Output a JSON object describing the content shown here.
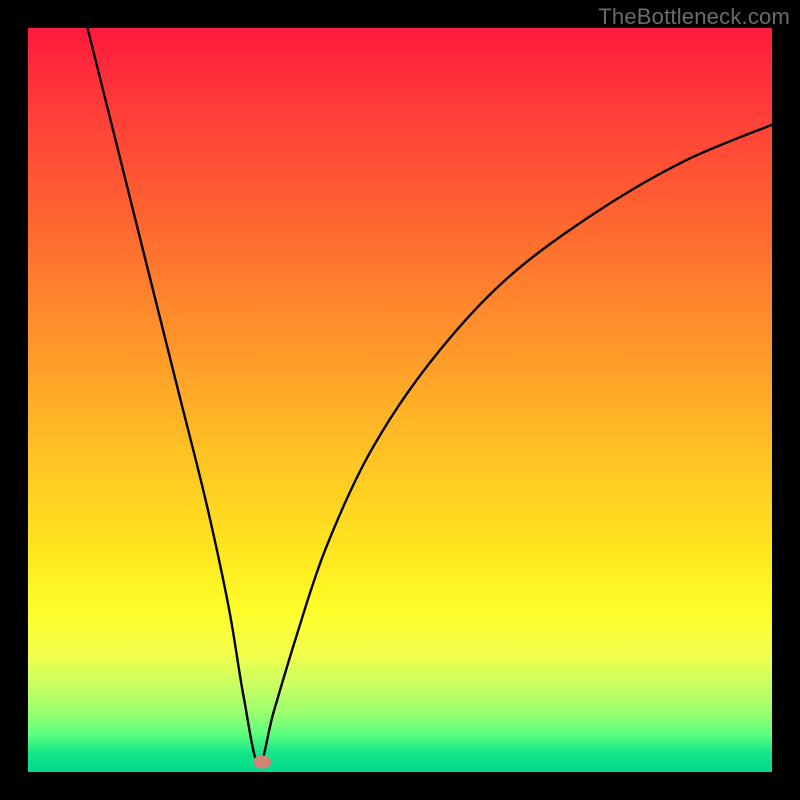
{
  "attribution": "TheBottleneck.com",
  "colors": {
    "frame_bg": "#000000",
    "marker": "#cf8476",
    "curve": "#000000"
  },
  "chart_data": {
    "type": "line",
    "title": "",
    "xlabel": "",
    "ylabel": "",
    "xlim": [
      0,
      100
    ],
    "ylim": [
      0,
      100
    ],
    "minimum_x": 31,
    "minimum_y": 1,
    "marker": {
      "x_pct": 31.5,
      "y_pct": 98.6
    },
    "series": [
      {
        "name": "bottleneck-curve",
        "points": [
          {
            "x": 8,
            "y": 100
          },
          {
            "x": 12,
            "y": 84
          },
          {
            "x": 16,
            "y": 68
          },
          {
            "x": 20,
            "y": 52
          },
          {
            "x": 24,
            "y": 36
          },
          {
            "x": 27,
            "y": 22
          },
          {
            "x": 29,
            "y": 10
          },
          {
            "x": 31,
            "y": 1
          },
          {
            "x": 33,
            "y": 8
          },
          {
            "x": 36,
            "y": 18
          },
          {
            "x": 40,
            "y": 30
          },
          {
            "x": 46,
            "y": 43
          },
          {
            "x": 54,
            "y": 55
          },
          {
            "x": 64,
            "y": 66
          },
          {
            "x": 76,
            "y": 75
          },
          {
            "x": 88,
            "y": 82
          },
          {
            "x": 100,
            "y": 87
          }
        ]
      }
    ]
  }
}
